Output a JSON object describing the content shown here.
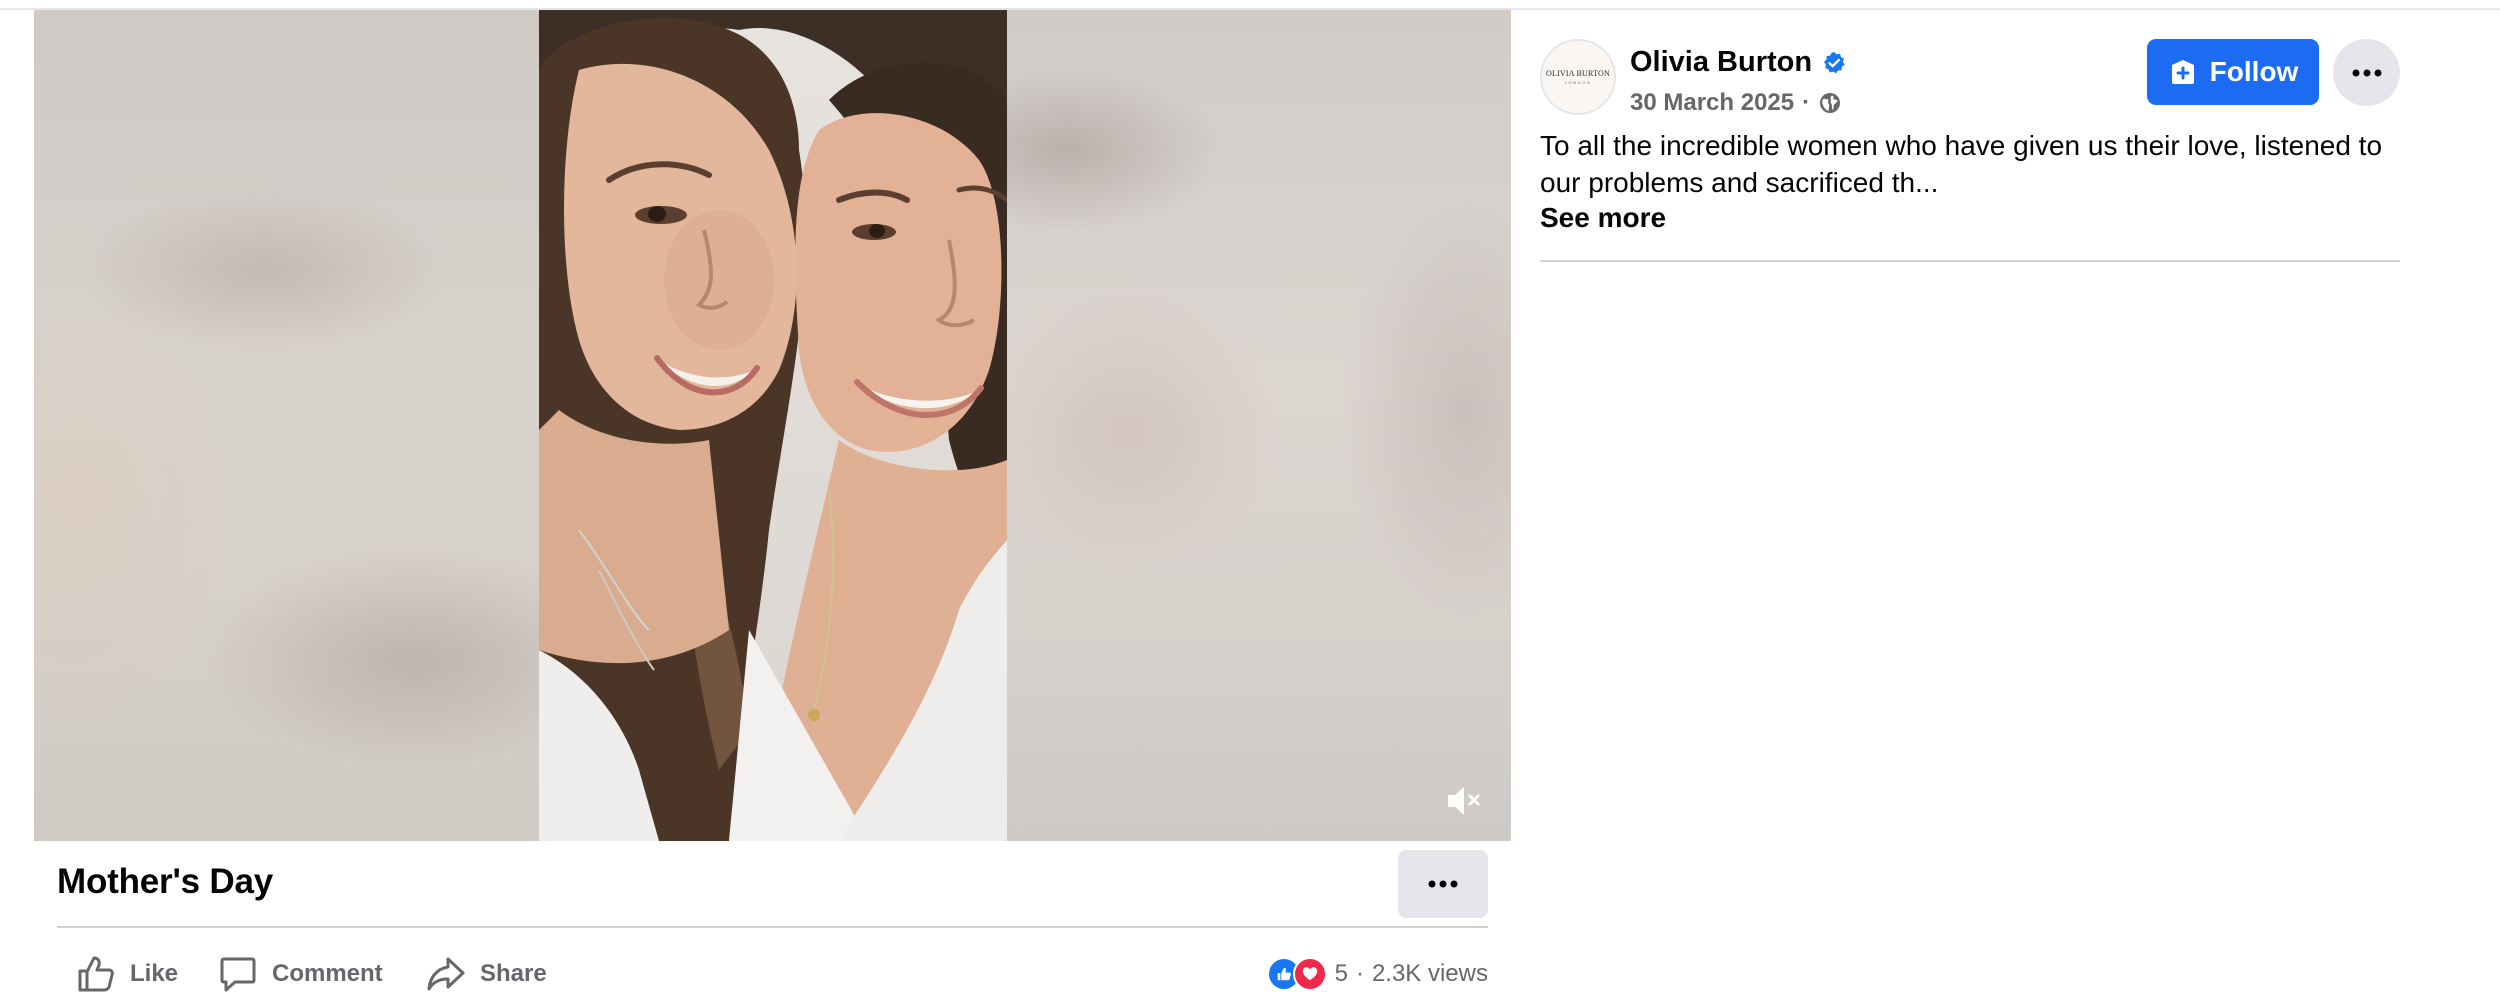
{
  "post": {
    "title": "Mother's Day",
    "author": "Olivia Burton",
    "date": "30 March 2025",
    "date_separator": "·",
    "caption": "To all the incredible women who have given us their love, listened to our problems and sacrificed th...",
    "see_more": "See more",
    "follow_label": "Follow"
  },
  "avatar": {
    "logo_text": "OLIVIA BURTON",
    "logo_sub": "LONDON"
  },
  "actions": {
    "like": "Like",
    "comment": "Comment",
    "share": "Share"
  },
  "stats": {
    "reaction_count": "5",
    "separator": "·",
    "views": "2.3K views"
  },
  "colors": {
    "accent": "#1b6cf2",
    "verified": "#1877f2",
    "love": "#f02849",
    "secondary_text": "#65676b",
    "button_gray": "#e4e6eb"
  },
  "icons": {
    "mute": "speaker-muted-icon",
    "verified": "verified-badge-icon",
    "globe": "globe-icon",
    "follow": "add-follow-icon",
    "more": "more-horizontal-icon",
    "like": "thumbs-up-icon",
    "comment": "comment-icon",
    "share": "share-icon"
  }
}
